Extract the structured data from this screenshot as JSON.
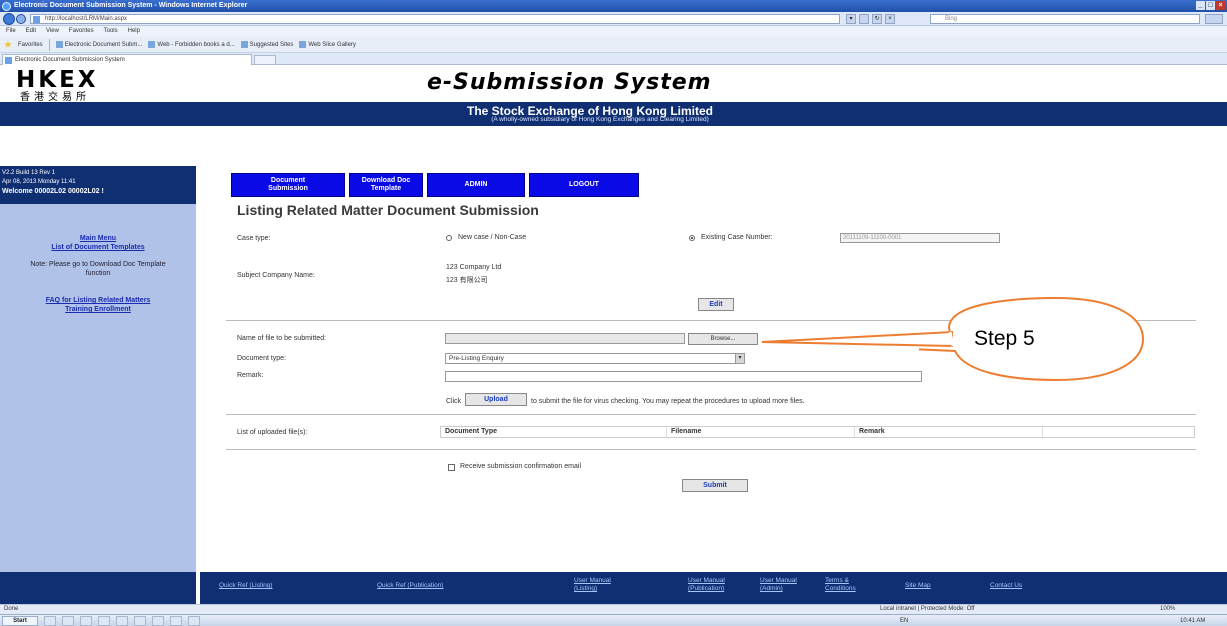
{
  "browser": {
    "title": "Electronic Document Submission System - Windows Internet Explorer",
    "url": "http://localhost/LRM/Main.aspx",
    "search_placeholder": "Bing",
    "menu": [
      "File",
      "Edit",
      "View",
      "Favorites",
      "Tools",
      "Help"
    ],
    "favorites_label": "Favorites",
    "favorites_links": [
      "Electronic Document Subm...",
      "Web - Forbidden books a d...",
      "Suggested Sites",
      "Web Slice Gallery"
    ],
    "tab_label": "Electronic Document Submission System",
    "status_text": "Done",
    "zone_text": "Local intranet | Protected Mode: Off",
    "zoom": "100%",
    "start_label": "Start",
    "tray_text": "EN",
    "clock": "10:41 AM"
  },
  "header": {
    "logo_text": "HKEX",
    "logo_cn": "香港交易所",
    "site_title": "e-Submission System",
    "banner_title": "The Stock Exchange of Hong Kong Limited",
    "banner_sub": "(A wholly-owned subsidiary of Hong Kong Exchanges and Clearing Limited)"
  },
  "sidebar": {
    "version": "V2.2 Build 13 Rev 1",
    "datetime": "Apr 08, 2013 Monday 11:41",
    "welcome": "Welcome 00002L02 00002L02 !",
    "links": [
      "Main Menu",
      "List of Document Templates"
    ],
    "note": "Note: Please go to Download Doc Template function",
    "links2": [
      "FAQ for Listing Related Matters",
      "Training Enrollment"
    ]
  },
  "nav": {
    "buttons": [
      "Document Submission",
      "Download Doc Template",
      "ADMIN",
      "LOGOUT"
    ]
  },
  "form": {
    "heading": "Listing Related Matter Document Submission",
    "case_type_label": "Case type:",
    "new_case_label": "New case / Non-Case",
    "existing_case_label": "Existing Case Number:",
    "existing_case_value": "20111109-11100-0001",
    "subject_company_label": "Subject Company Name:",
    "company_name_en": "123 Company Ltd",
    "company_name_cn": "123 有限公司",
    "edit_button": "Edit",
    "file_label": "Name of file to be submitted:",
    "browse_button": "Browse...",
    "doc_type_label": "Document type:",
    "doc_type_value": "Pre-Listing Enquiry",
    "remark_label": "Remark:",
    "click_label": "Click",
    "upload_button": "Upload",
    "upload_help": "to submit the file for virus checking. You may repeat the procedures to upload more files.",
    "uploaded_label": "List of uploaded file(s):",
    "table_headers": [
      "Document Type",
      "Filename",
      "Remark",
      ""
    ],
    "confirm_email_label": "Receive submission confirmation email",
    "submit_button": "Submit"
  },
  "footer": {
    "links": [
      "Quick Ref (Listing)",
      "Quick Ref (Publication)",
      "User Manual (Listing)",
      "User Manual (Publication)",
      "User Manual (Admin)",
      "Terms & Conditions",
      "Site Map",
      "Contact Us"
    ]
  },
  "callout": {
    "text": "Step 5",
    "color": "#ed7d31"
  }
}
